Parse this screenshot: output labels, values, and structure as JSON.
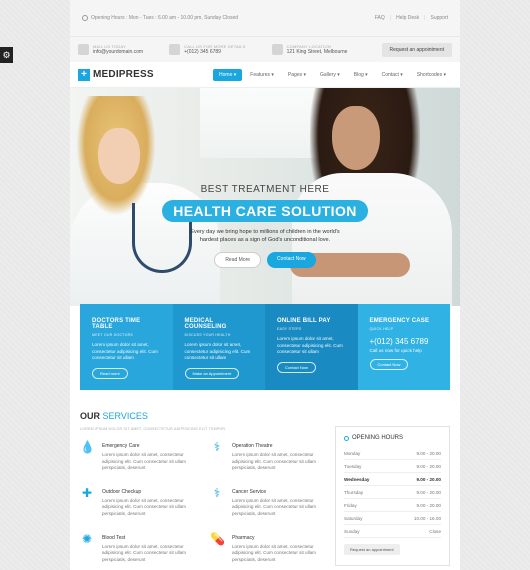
{
  "topbar": {
    "hours": "Opening Hours : Mon - Tues : 6.00 am - 10.00 pm, Sunday Closed",
    "links": [
      "FAQ",
      "Help Desk",
      "Support"
    ]
  },
  "contact": {
    "mail_label": "MAIL US TODAY",
    "mail_value": "info@yourdomain.com",
    "call_label": "CALL US FOR MORE DETAILS",
    "call_value": "+(012) 345 6789",
    "location_label": "COMPANY LOCATION",
    "location_value": "121 King Street, Melbourne",
    "appointment_button": "Request an appointment"
  },
  "header": {
    "logo_mark": "+",
    "logo_text": "MEDIPRESS",
    "nav": [
      "Home ▾",
      "Features ▾",
      "Pages ▾",
      "Gallery ▾",
      "Blog ▾",
      "Contact ▾",
      "Shortcodes ▾"
    ]
  },
  "hero": {
    "kicker": "BEST TREATMENT HERE",
    "title": "HEALTH CARE SOLUTION",
    "desc_line1": "Every day we bring hope to millions of children in the world's",
    "desc_line2": "hardest places as a sign of God's unconditional love.",
    "read_more": "Read More",
    "contact_now": "Contact Now"
  },
  "features": [
    {
      "title": "DOCTORS TIME TABLE",
      "sub": "MEET OUR DOCTORS",
      "text": "Lorem ipsum dolor sit amet, consectetur adipisicing elit. Cum consectetur sit ullam",
      "button": "Read more"
    },
    {
      "title": "MEDICAL COUNSELING",
      "sub": "DISCUSS YOUR HEALTH",
      "text": "Lorem ipsum dolor sit amet, consectetur adipisicing elit. Cum consectetur sit ullam",
      "button": "Make an Appointment"
    },
    {
      "title": "ONLINE BILL PAY",
      "sub": "EASY STEPS",
      "text": "Lorem ipsum dolor sit amet, consectetur adipisicing elit. Cum consectetur sit ullam",
      "button": "Contact Now"
    },
    {
      "title": "EMERGENCY CASE",
      "sub": "QUICK HELP",
      "phone": "+(012) 345 6789",
      "note": "Call us now for quick help",
      "button": "Contact Now"
    }
  ],
  "services": {
    "title_a": "OUR",
    "title_b": "SERVICES",
    "subtitle": "LOREM IPSUM DOLOR SIT AMET, CONSECTETUR ADIPISICING ELIT TEMPOR.",
    "items": [
      {
        "name": "Emergency Care",
        "icon": "drop-icon",
        "glyph": "💧",
        "text": "Lorem ipsum dolor sit amet, consectetur adipisicing elit. Cum consectetur sit ullam perspiciatis, deserunt"
      },
      {
        "name": "Operation Theatre",
        "icon": "molecule-icon",
        "glyph": "⚕",
        "text": "Lorem ipsum dolor sit amet, consectetur adipisicing elit. Cum consectetur sit ullam perspiciatis, deserunt"
      },
      {
        "name": "Outdoor Checkup",
        "icon": "syringe-icon",
        "glyph": "✚",
        "text": "Lorem ipsum dolor sit amet, consectetur adipisicing elit. Cum consectetur sit ullam perspiciatis, deserunt"
      },
      {
        "name": "Cancer Service",
        "icon": "caduceus-icon",
        "glyph": "⚕",
        "text": "Lorem ipsum dolor sit amet, consectetur adipisicing elit. Cum consectetur sit ullam perspiciatis, deserunt"
      },
      {
        "name": "Blood Test",
        "icon": "virus-icon",
        "glyph": "✺",
        "text": "Lorem ipsum dolor sit amet, consectetur adipisicing elit. Cum consectetur sit ullam perspiciatis, deserunt"
      },
      {
        "name": "Pharmacy",
        "icon": "pill-icon",
        "glyph": "💊",
        "text": "Lorem ipsum dolor sit amet, consectetur adipisicing elit. Cum consectetur sit ullam perspiciatis, deserunt"
      }
    ]
  },
  "opening_hours": {
    "title": "OPENING HOURS",
    "rows": [
      {
        "day": "Monday",
        "time": "9.00 - 20.00"
      },
      {
        "day": "Tuesday",
        "time": "9.00 - 20.00"
      },
      {
        "day": "Wednesday",
        "time": "9.00 - 20.00"
      },
      {
        "day": "Thursday",
        "time": "9.00 - 20.00"
      },
      {
        "day": "Friday",
        "time": "9.00 - 20.00"
      },
      {
        "day": "Saturday",
        "time": "10.00 - 16.00"
      },
      {
        "day": "Sunday",
        "time": "Close"
      }
    ],
    "button": "Request an appointment"
  },
  "colors": {
    "accent": "#1aa7e0"
  }
}
